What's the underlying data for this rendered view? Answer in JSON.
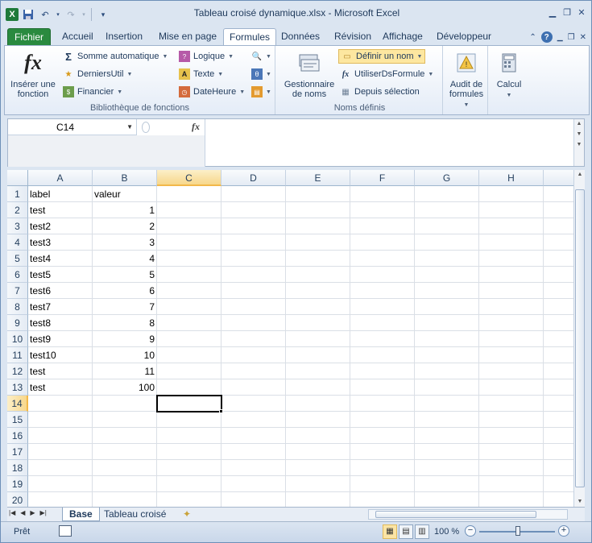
{
  "window": {
    "title": "Tableau croisé dynamique.xlsx - Microsoft Excel",
    "app_icon": "excel-logo"
  },
  "ribbon_tabs": [
    "Fichier",
    "Accueil",
    "Insertion",
    "Mise en page",
    "Formules",
    "Données",
    "Révision",
    "Affichage",
    "Développeur"
  ],
  "active_tab": "Formules",
  "ribbon": {
    "function_library": {
      "insert_function": "Insérer une fonction",
      "autosum": "Somme automatique",
      "recent": "DerniersUtil",
      "financial": "Financier",
      "logical": "Logique",
      "text": "Texte",
      "datetime": "DateHeure",
      "group_label": "Bibliothèque de fonctions"
    },
    "defined_names": {
      "name_manager": "Gestionnaire de noms",
      "define_name": "Définir un nom",
      "use_in_formula": "UtiliserDsFormule",
      "from_selection": "Depuis sélection",
      "group_label": "Noms définis"
    },
    "audit": "Audit de formules",
    "calc": "Calcul"
  },
  "formula_bar": {
    "name_box": "C14",
    "fx_label": "fx",
    "formula": ""
  },
  "columns": [
    "A",
    "B",
    "C",
    "D",
    "E",
    "F",
    "G",
    "H"
  ],
  "selected_column": "C",
  "rows": [
    "1",
    "2",
    "3",
    "4",
    "5",
    "6",
    "7",
    "8",
    "9",
    "10",
    "11",
    "12",
    "13",
    "14",
    "15",
    "16",
    "17",
    "18",
    "19",
    "20"
  ],
  "selected_row": "14",
  "cells": [
    [
      "label",
      "valeur"
    ],
    [
      "test",
      "1"
    ],
    [
      "test2",
      "2"
    ],
    [
      "test3",
      "3"
    ],
    [
      "test4",
      "4"
    ],
    [
      "test5",
      "5"
    ],
    [
      "test6",
      "6"
    ],
    [
      "test7",
      "7"
    ],
    [
      "test8",
      "8"
    ],
    [
      "test9",
      "9"
    ],
    [
      "test10",
      "10"
    ],
    [
      "test",
      "11"
    ],
    [
      "test",
      "100"
    ]
  ],
  "sheets": [
    "Base",
    "Tableau croisé"
  ],
  "active_sheet": "Base",
  "status": {
    "ready": "Prêt",
    "zoom": "100 %"
  }
}
